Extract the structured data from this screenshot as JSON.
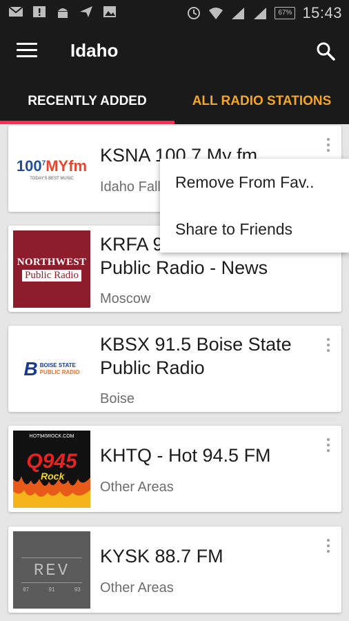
{
  "status_bar": {
    "time": "15:43",
    "battery": "67%"
  },
  "app_bar": {
    "title": "Idaho",
    "menu_icon": "hamburger-icon",
    "search_icon": "search-icon"
  },
  "tabs": [
    {
      "label": "RECENTLY ADDED",
      "active": true
    },
    {
      "label": "ALL RADIO STATIONS",
      "active": false
    }
  ],
  "colors": {
    "bar": "#1a1a1a",
    "accent_tab": "#f5a623",
    "indicator": "#ff2d55"
  },
  "stations": [
    {
      "name": "KSNA 100.7 My fm",
      "location": "Idaho Falls",
      "logo": {
        "main": "100",
        "sup": "7",
        "brand": "MYfm",
        "tagline": "TODAY'S BEST MUSIC"
      }
    },
    {
      "name": "KRFA 91.7 Northwest Public Radio - News",
      "location": "Moscow",
      "logo": {
        "line1": "NORTHWEST",
        "line2": "Public Radio"
      }
    },
    {
      "name": "KBSX 91.5 Boise State Public Radio",
      "location": "Boise",
      "logo": {
        "line1": "BOISE STATE",
        "line2": "PUBLIC RADIO"
      }
    },
    {
      "name": "KHTQ - Hot 94.5 FM",
      "location": "Other Areas",
      "logo": {
        "top": "HOT945ROCK.COM",
        "main": "Q945",
        "script": "Rock"
      }
    },
    {
      "name": "KYSK 88.7 FM",
      "location": "Other Areas",
      "logo": {
        "main": "REV",
        "nums": [
          "87",
          "91",
          "93"
        ]
      }
    }
  ],
  "popup_menu": [
    "Remove From Fav..",
    "Share to Friends"
  ]
}
